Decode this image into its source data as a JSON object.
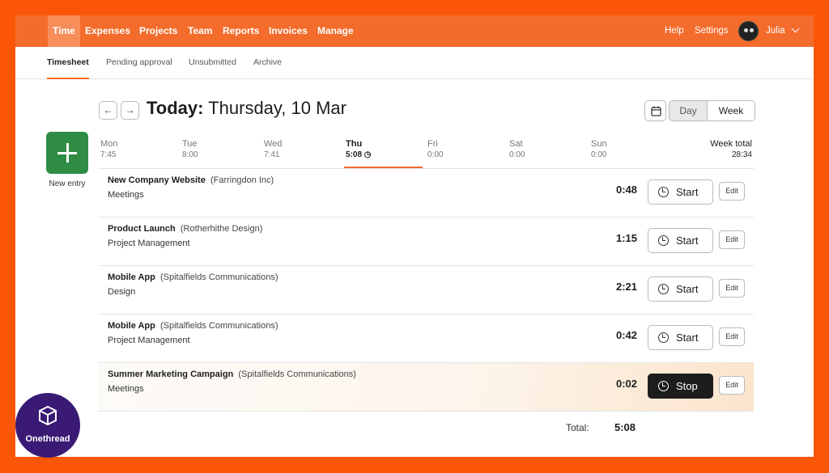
{
  "topnav": {
    "items": [
      "Time",
      "Expenses",
      "Projects",
      "Team",
      "Reports",
      "Invoices",
      "Manage"
    ],
    "help": "Help",
    "settings": "Settings",
    "user": "Julia"
  },
  "subnav": {
    "tabs": [
      "Timesheet",
      "Pending approval",
      "Unsubmitted",
      "Archive"
    ]
  },
  "header": {
    "prev": "←",
    "next": "→",
    "today_label": "Today:",
    "date": "Thursday, 10 Mar",
    "view_day": "Day",
    "view_week": "Week"
  },
  "new_entry": {
    "label": "New entry"
  },
  "days": [
    {
      "name": "Mon",
      "time": "7:45"
    },
    {
      "name": "Tue",
      "time": "8:00"
    },
    {
      "name": "Wed",
      "time": "7:41"
    },
    {
      "name": "Thu",
      "time": "5:08"
    },
    {
      "name": "Fri",
      "time": "0:00"
    },
    {
      "name": "Sat",
      "time": "0:00"
    },
    {
      "name": "Sun",
      "time": "0:00"
    }
  ],
  "week_total": {
    "label": "Week total",
    "value": "28:34"
  },
  "entries": [
    {
      "project": "New Company Website",
      "client": "(Farringdon Inc)",
      "task": "Meetings",
      "duration": "0:48",
      "action": "Start",
      "edit": "Edit"
    },
    {
      "project": "Product Launch",
      "client": "(Rotherhithe Design)",
      "task": "Project Management",
      "duration": "1:15",
      "action": "Start",
      "edit": "Edit"
    },
    {
      "project": "Mobile App",
      "client": "(Spitalfields Communications)",
      "task": "Design",
      "duration": "2:21",
      "action": "Start",
      "edit": "Edit"
    },
    {
      "project": "Mobile App",
      "client": "(Spitalfields Communications)",
      "task": "Project Management",
      "duration": "0:42",
      "action": "Start",
      "edit": "Edit"
    },
    {
      "project": "Summer Marketing Campaign",
      "client": "(Spitalfields Communications)",
      "task": "Meetings",
      "duration": "0:02",
      "action": "Stop",
      "edit": "Edit"
    }
  ],
  "total": {
    "label": "Total:",
    "value": "5:08"
  },
  "brand": {
    "name": "Onethread"
  },
  "colors": {
    "accent": "#f36c2c",
    "frame": "#fb5607",
    "new_entry": "#2f8c44",
    "badge": "#3a1a75"
  }
}
